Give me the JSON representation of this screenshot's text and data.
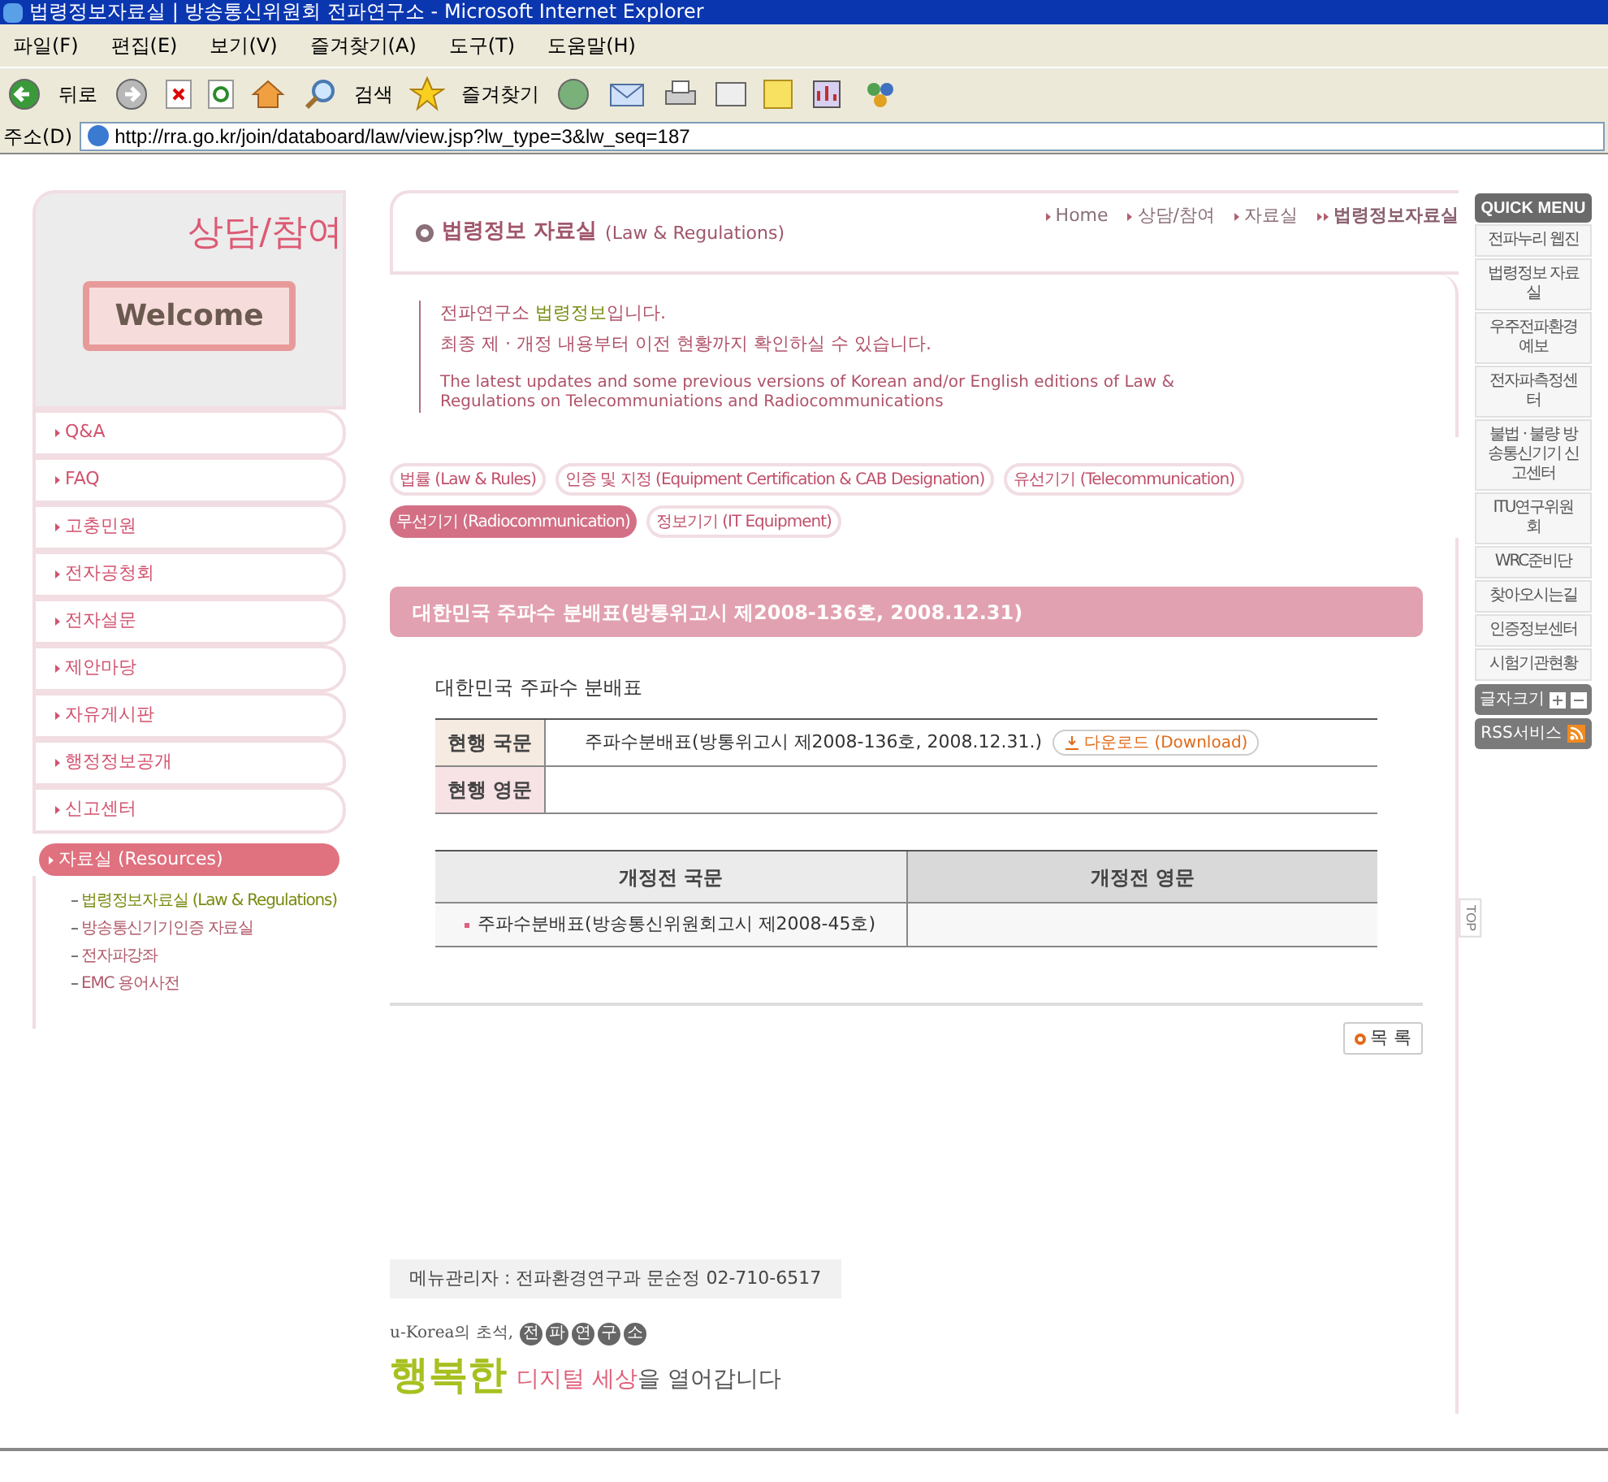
{
  "window": {
    "title": "법령정보자료실 | 방송통신위원회 전파연구소 - Microsoft Internet Explorer"
  },
  "menu_bar": [
    "파일(F)",
    "편집(E)",
    "보기(V)",
    "즐겨찾기(A)",
    "도구(T)",
    "도움말(H)"
  ],
  "toolbar": {
    "back": "뒤로",
    "search": "검색",
    "favorites": "즐겨찾기"
  },
  "address_bar": {
    "label": "주소(D)",
    "url": "http://rra.go.kr/join/databoard/law/view.jsp?lw_type=3&lw_seq=187"
  },
  "sidebar": {
    "title": "상담/참여",
    "banner": "Welcome",
    "items": [
      {
        "label": "Q&A",
        "selected": false
      },
      {
        "label": "FAQ",
        "selected": false
      },
      {
        "label": "고충민원",
        "selected": false
      },
      {
        "label": "전자공청회",
        "selected": false
      },
      {
        "label": "전자설문",
        "selected": false
      },
      {
        "label": "제안마당",
        "selected": false
      },
      {
        "label": "자유게시판",
        "selected": false
      },
      {
        "label": "행정정보공개",
        "selected": false
      },
      {
        "label": "신고센터",
        "selected": false
      },
      {
        "label": "자료실 (Resources)",
        "selected": true,
        "children": [
          {
            "label": "법령정보자료실 (Law & Regulations)",
            "selected": true
          },
          {
            "label": "방송통신기기인증 자료실",
            "selected": false
          },
          {
            "label": "전자파강좌",
            "selected": false
          },
          {
            "label": "EMC 용어사전",
            "selected": false
          }
        ]
      }
    ]
  },
  "breadcrumb": [
    {
      "label": "Home",
      "current": false
    },
    {
      "label": "상담/참여",
      "current": false
    },
    {
      "label": "자료실",
      "current": false
    },
    {
      "label": "법령정보자료실",
      "current": true
    }
  ],
  "heading": {
    "title": "법령정보 자료실",
    "subtitle": "(Law & Regulations)"
  },
  "intro": {
    "prefix": "전파연구소 ",
    "highlight": "법령정보",
    "suffix": "입니다.",
    "line2": "최종 제 · 개정 내용부터 이전 현황까지 확인하실 수 있습니다.",
    "english": "The latest updates and some previous versions of Korean and/or English editions of Law & Regulations on Telecommuniations and Radiocommunications"
  },
  "category_tabs": [
    {
      "label": "법률 (Law & Rules)",
      "selected": false
    },
    {
      "label": "인증 및 지정 (Equipment Certification & CAB Designation)",
      "selected": false
    },
    {
      "label": "유선기기 (Telecommunication)",
      "selected": false
    },
    {
      "label": "무선기기 (Radiocommunication)",
      "selected": true
    },
    {
      "label": "정보기기 (IT Equipment)",
      "selected": false
    }
  ],
  "article": {
    "title": "대한민국 주파수 분배표(방통위고시 제2008-136호, 2008.12.31)",
    "subtitle": "대한민국 주파수 분배표",
    "current": [
      {
        "label": "현행 국문",
        "value": "주파수분배표(방통위고시 제2008-136호, 2008.12.31.)",
        "download": "다운로드 (Download)"
      },
      {
        "label": "현행 영문"
      }
    ],
    "previous": {
      "columns": [
        "개정전 국문",
        "개정전 영문"
      ],
      "rows": [
        [
          "주파수분배표(방송통신위원회고시 제2008-45호)"
        ]
      ]
    }
  },
  "list_button": "목 록",
  "footer": {
    "manager": "메뉴관리자 : 전파환경연구과 문순정 02-710-6517",
    "slogan_prefix": "u-Korea의 초석,",
    "badges": [
      "전",
      "파",
      "연",
      "구",
      "소"
    ],
    "slogan_big": "행복한",
    "slogan_pink": "디지털 세상",
    "slogan_rest": "을 열어갑니다"
  },
  "quick_menu": {
    "title": "QUICK MENU",
    "items": [
      "전파누리 웹진",
      "법령정보 자료실",
      "우주전파환경예보",
      "전자파측정센터",
      "불법 · 불량 방송통신기기 신고센터",
      "ITU연구위원회",
      "WRC준비단",
      "찾아오시는길",
      "인증정보센터",
      "시험기관현황"
    ],
    "font_size": "글자크기",
    "rss": "RSS서비스",
    "top": "TOP"
  }
}
